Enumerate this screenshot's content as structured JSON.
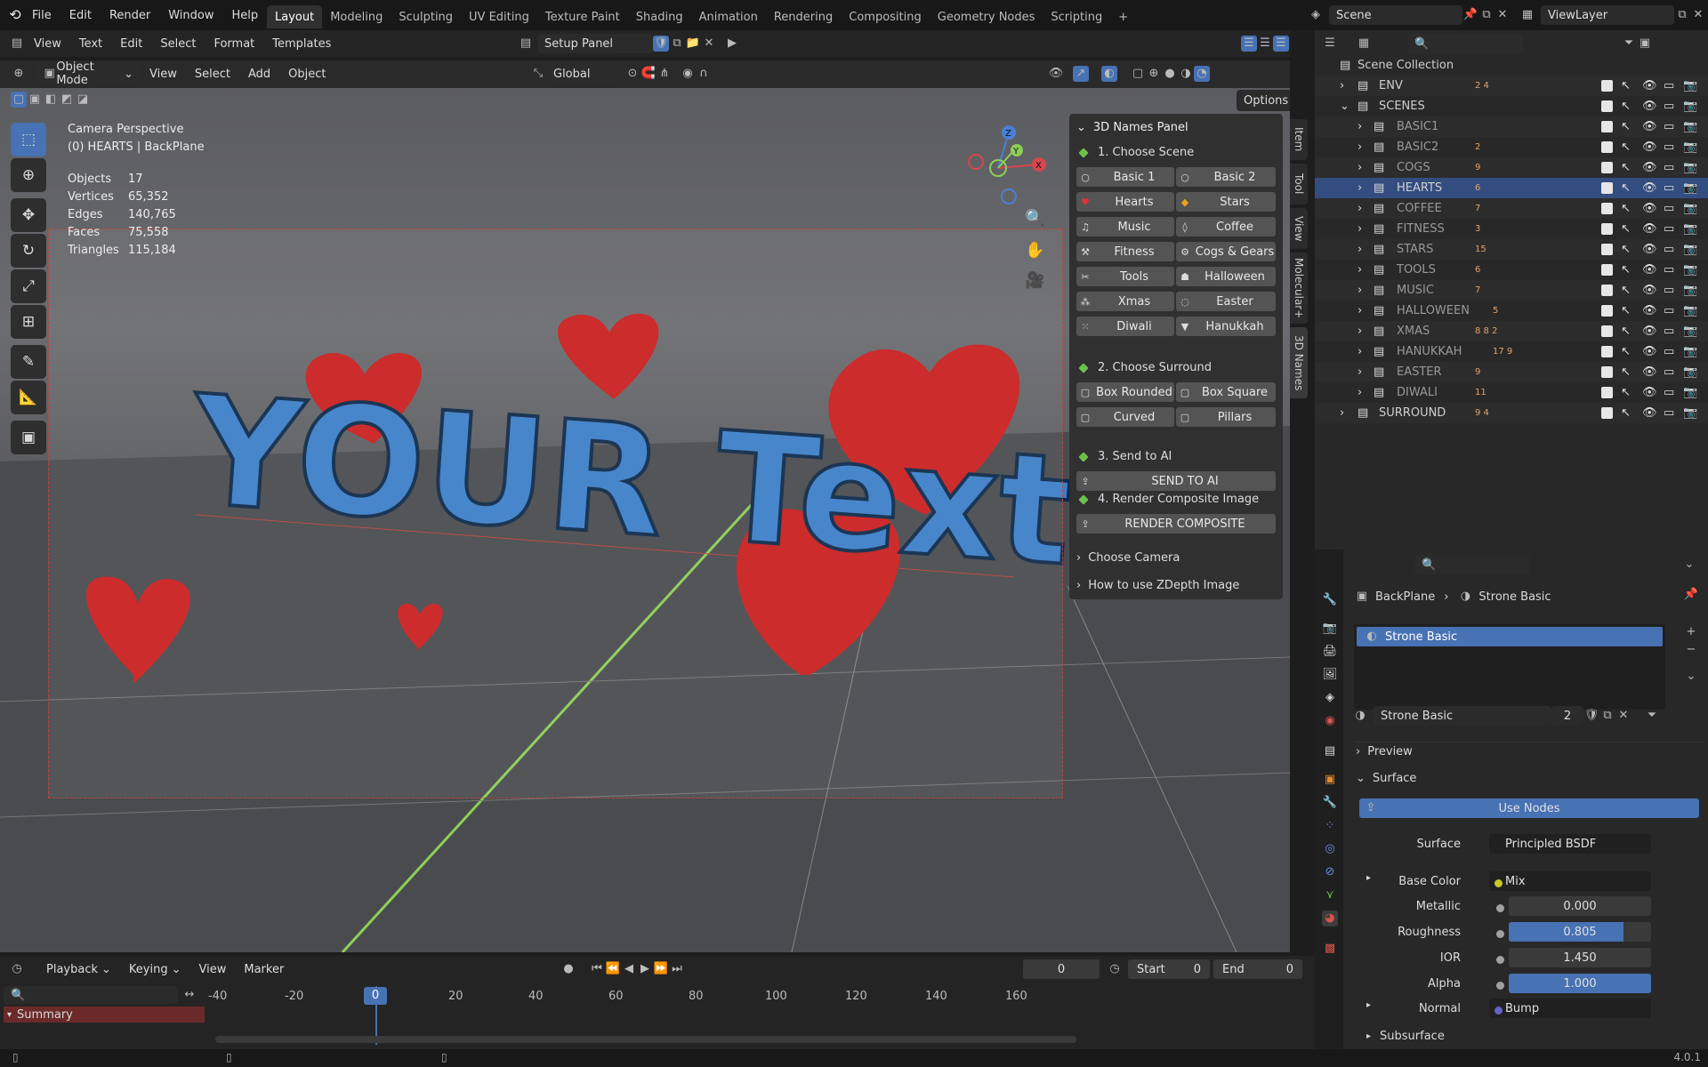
{
  "topbar": {
    "menus": [
      "File",
      "Edit",
      "Render",
      "Window",
      "Help"
    ],
    "workspaces": [
      "Layout",
      "Modeling",
      "Sculpting",
      "UV Editing",
      "Texture Paint",
      "Shading",
      "Animation",
      "Rendering",
      "Compositing",
      "Geometry Nodes",
      "Scripting",
      "+"
    ],
    "scene": "Scene",
    "viewlayer": "ViewLayer"
  },
  "text_header": {
    "menus": [
      "View",
      "Text",
      "Edit",
      "Select",
      "Format",
      "Templates"
    ],
    "file": "Setup Panel"
  },
  "viewport_header": {
    "mode": "Object Mode",
    "menus": [
      "View",
      "Select",
      "Add",
      "Object"
    ],
    "orientation": "Global",
    "options": "Options"
  },
  "viewport": {
    "camera_title": "Camera Perspective",
    "camera_sub": "(0) HEARTS | BackPlane",
    "stats": [
      [
        "Objects",
        "17"
      ],
      [
        "Vertices",
        "65,352"
      ],
      [
        "Edges",
        "140,765"
      ],
      [
        "Faces",
        "75,558"
      ],
      [
        "Triangles",
        "115,184"
      ]
    ],
    "scene_text": "YOUR Text",
    "gizmo": {
      "x": "X",
      "y": "Y",
      "z": "Z"
    }
  },
  "npanel": {
    "title": "3D Names Panel",
    "step1": "1. Choose Scene",
    "scenes": [
      "Basic 1",
      "Basic 2",
      "Hearts",
      "Stars",
      "Music",
      "Coffee",
      "Fitness",
      "Cogs & Gears",
      "Tools",
      "Halloween",
      "Xmas",
      "Easter",
      "Diwali",
      "Hanukkah"
    ],
    "step2": "2. Choose Surround",
    "surrounds": [
      "Box Rounded",
      "Box Square",
      "Curved",
      "Pillars"
    ],
    "step3": "3. Send to AI",
    "send": "SEND TO AI",
    "step4": "4. Render Composite Image",
    "render": "RENDER COMPOSITE",
    "choose_camera": "Choose Camera",
    "zdepth": "How to use ZDepth Image"
  },
  "vtabs": [
    "Item",
    "Tool",
    "View",
    "Molecular+",
    "3D Names"
  ],
  "outliner": {
    "root": "Scene Collection",
    "rows": [
      {
        "name": "ENV",
        "badge": "2  4"
      },
      {
        "name": "SCENES",
        "badge": ""
      },
      {
        "name": "BASIC1",
        "badge": ""
      },
      {
        "name": "BASIC2",
        "badge": "2"
      },
      {
        "name": "COGS",
        "badge": "9"
      },
      {
        "name": "HEARTS",
        "badge": "6"
      },
      {
        "name": "COFFEE",
        "badge": "7"
      },
      {
        "name": "FITNESS",
        "badge": "3"
      },
      {
        "name": "STARS",
        "badge": "15"
      },
      {
        "name": "TOOLS",
        "badge": "6"
      },
      {
        "name": "MUSIC",
        "badge": "7"
      },
      {
        "name": "HALLOWEEN",
        "badge": "5"
      },
      {
        "name": "XMAS",
        "badge": "8  8  2"
      },
      {
        "name": "HANUKKAH",
        "badge": "17  9"
      },
      {
        "name": "EASTER",
        "badge": "9"
      },
      {
        "name": "DIWALI",
        "badge": "11"
      },
      {
        "name": "SURROUND",
        "badge": "9  4"
      }
    ]
  },
  "properties": {
    "crumb_obj": "BackPlane",
    "crumb_mat": "Strone Basic",
    "slot": "Strone Basic",
    "material": "Strone Basic",
    "users": "2",
    "preview": "Preview",
    "surface_hdr": "Surface",
    "use_nodes": "Use Nodes",
    "rows": [
      {
        "label": "Surface",
        "value": "Principled BSDF",
        "color": "#6cc14a"
      },
      {
        "label": "Base Color",
        "value": "Mix",
        "color": "#c7c729"
      },
      {
        "label": "Metallic",
        "value": "0.000",
        "color": "#a1a1a1"
      },
      {
        "label": "Roughness",
        "value": "0.805",
        "color": "#a1a1a1",
        "fill": 0.805
      },
      {
        "label": "IOR",
        "value": "1.450",
        "color": "#a1a1a1"
      },
      {
        "label": "Alpha",
        "value": "1.000",
        "color": "#a1a1a1",
        "fill": 1.0
      },
      {
        "label": "Normal",
        "value": "Bump",
        "color": "#6363c7"
      }
    ],
    "subsurface": "Subsurface"
  },
  "timeline": {
    "menus": [
      "Playback",
      "Keying",
      "View",
      "Marker"
    ],
    "frame": "0",
    "start_label": "Start",
    "start": "0",
    "end_label": "End",
    "end": "0",
    "ticks": [
      "-40",
      "-20",
      "0",
      "20",
      "40",
      "60",
      "80",
      "100",
      "120",
      "140",
      "160"
    ],
    "summary": "Summary"
  },
  "status": {
    "version": "4.0.1"
  },
  "colors": {
    "accent": "#4772b3",
    "bg": "#1d1d1d",
    "panel": "#303030"
  }
}
